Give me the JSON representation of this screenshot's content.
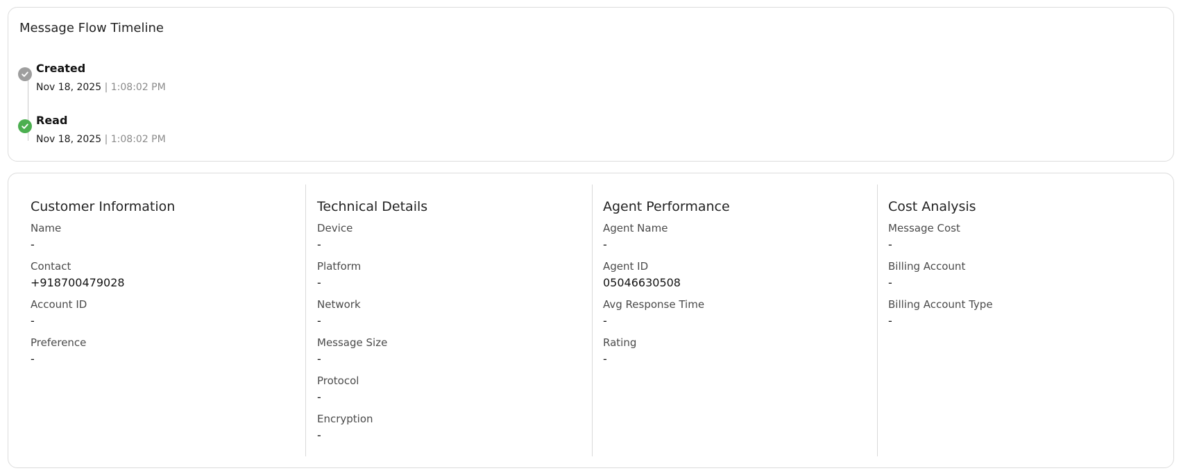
{
  "timeline": {
    "title": "Message Flow Timeline",
    "events": [
      {
        "label": "Created",
        "date": "Nov 18, 2025",
        "separator": "|",
        "time": "1:08:02 PM",
        "status_color": "#9e9e9e"
      },
      {
        "label": "Read",
        "date": "Nov 18, 2025",
        "separator": "|",
        "time": "1:08:02 PM",
        "status_color": "#4caf50"
      }
    ]
  },
  "details": {
    "customer": {
      "title": "Customer Information",
      "fields": [
        {
          "label": "Name",
          "value": "-"
        },
        {
          "label": "Contact",
          "value": "+918700479028"
        },
        {
          "label": "Account ID",
          "value": "-"
        },
        {
          "label": "Preference",
          "value": "-"
        }
      ]
    },
    "technical": {
      "title": "Technical Details",
      "fields": [
        {
          "label": "Device",
          "value": "-"
        },
        {
          "label": "Platform",
          "value": "-"
        },
        {
          "label": "Network",
          "value": "-"
        },
        {
          "label": "Message Size",
          "value": "-"
        },
        {
          "label": "Protocol",
          "value": "-"
        },
        {
          "label": "Encryption",
          "value": "-"
        }
      ]
    },
    "agent": {
      "title": "Agent Performance",
      "fields": [
        {
          "label": "Agent Name",
          "value": "-"
        },
        {
          "label": "Agent ID",
          "value": "05046630508"
        },
        {
          "label": "Avg Response Time",
          "value": "-"
        },
        {
          "label": "Rating",
          "value": "-"
        }
      ]
    },
    "cost": {
      "title": "Cost Analysis",
      "fields": [
        {
          "label": "Message Cost",
          "value": "-"
        },
        {
          "label": "Billing Account",
          "value": "-"
        },
        {
          "label": "Billing Account Type",
          "value": "-"
        }
      ]
    }
  }
}
